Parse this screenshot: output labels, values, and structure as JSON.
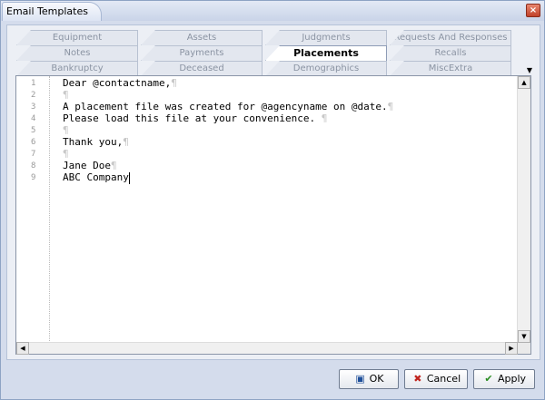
{
  "window": {
    "title": "Email Templates",
    "close_glyph": "×"
  },
  "tabs": {
    "row1": [
      "Equipment",
      "Assets",
      "Judgments",
      "Requests And Responses"
    ],
    "row2": [
      "Notes",
      "Payments",
      "Placements",
      "Recalls"
    ],
    "row3": [
      "Bankruptcy",
      "Deceased",
      "Demographics",
      "MiscExtra"
    ],
    "active": "Placements"
  },
  "editor": {
    "line_numbers": [
      "1",
      "2",
      "3",
      "4",
      "5",
      "6",
      "7",
      "8",
      "9"
    ],
    "lines": [
      "Dear @contactname,",
      "",
      "A placement file was created for @agencyname on @date.",
      "Please load this file at your convenience. ",
      "",
      "Thank you,",
      "",
      "Jane Doe",
      "ABC Company"
    ],
    "pilcrow": "¶"
  },
  "buttons": {
    "ok": "OK",
    "cancel": "Cancel",
    "apply": "Apply"
  },
  "icons": {
    "ok": "save-icon",
    "cancel": "cancel-icon",
    "apply": "checkmark-icon"
  }
}
